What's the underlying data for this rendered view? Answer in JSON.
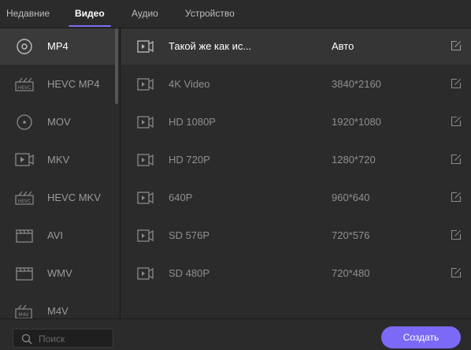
{
  "tabs": [
    {
      "label": "Недавние",
      "active": false
    },
    {
      "label": "Видео",
      "active": true
    },
    {
      "label": "Аудио",
      "active": false
    },
    {
      "label": "Устройство",
      "active": false
    }
  ],
  "accent_color": "#7b6cf6",
  "formats": [
    {
      "label": "MP4",
      "icon": "disc-icon",
      "selected": true
    },
    {
      "label": "HEVC MP4",
      "icon": "hevc-icon",
      "selected": false
    },
    {
      "label": "MOV",
      "icon": "disc-icon",
      "selected": false
    },
    {
      "label": "MKV",
      "icon": "video-file-icon",
      "selected": false
    },
    {
      "label": "HEVC MKV",
      "icon": "hevc-icon",
      "selected": false
    },
    {
      "label": "AVI",
      "icon": "clapperboard-icon",
      "selected": false
    },
    {
      "label": "WMV",
      "icon": "clapperboard-icon",
      "selected": false
    },
    {
      "label": "M4V",
      "icon": "m4v-icon",
      "selected": false
    }
  ],
  "presets": [
    {
      "name": "Такой же как ис...",
      "resolution": "Авто",
      "selected": true
    },
    {
      "name": "4K Video",
      "resolution": "3840*2160",
      "selected": false
    },
    {
      "name": "HD 1080P",
      "resolution": "1920*1080",
      "selected": false
    },
    {
      "name": "HD 720P",
      "resolution": "1280*720",
      "selected": false
    },
    {
      "name": "640P",
      "resolution": "960*640",
      "selected": false
    },
    {
      "name": "SD 576P",
      "resolution": "720*576",
      "selected": false
    },
    {
      "name": "SD 480P",
      "resolution": "720*480",
      "selected": false
    }
  ],
  "search": {
    "placeholder": "Поиск",
    "value": ""
  },
  "create_button": "Создать"
}
